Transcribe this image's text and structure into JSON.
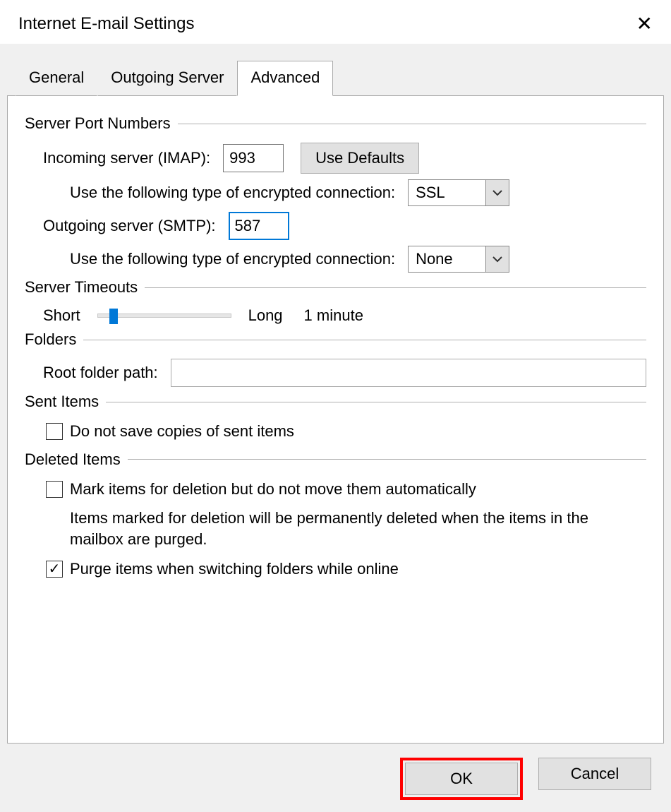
{
  "dialog": {
    "title": "Internet E-mail Settings"
  },
  "tabs": {
    "general": "General",
    "outgoing": "Outgoing Server",
    "advanced": "Advanced"
  },
  "groups": {
    "server_ports": "Server Port Numbers",
    "server_timeouts": "Server Timeouts",
    "folders": "Folders",
    "sent_items": "Sent Items",
    "deleted_items": "Deleted Items"
  },
  "server_ports": {
    "incoming_label": "Incoming server (IMAP):",
    "incoming_value": "993",
    "use_defaults": "Use Defaults",
    "incoming_enc_label": "Use the following type of encrypted connection:",
    "incoming_enc_value": "SSL",
    "outgoing_label": "Outgoing server (SMTP):",
    "outgoing_value": "587",
    "outgoing_enc_label": "Use the following type of encrypted connection:",
    "outgoing_enc_value": "None"
  },
  "timeouts": {
    "short_label": "Short",
    "long_label": "Long",
    "value_label": "1 minute"
  },
  "folders": {
    "root_label": "Root folder path:",
    "root_value": ""
  },
  "sent_items": {
    "do_not_save_label": "Do not save copies of sent items",
    "do_not_save_checked": false
  },
  "deleted_items": {
    "mark_label": "Mark items for deletion but do not move them automatically",
    "mark_checked": false,
    "mark_note": "Items marked for deletion will be permanently deleted when the items in the mailbox are purged.",
    "purge_label": "Purge items when switching folders while online",
    "purge_checked": true
  },
  "footer": {
    "ok": "OK",
    "cancel": "Cancel"
  }
}
